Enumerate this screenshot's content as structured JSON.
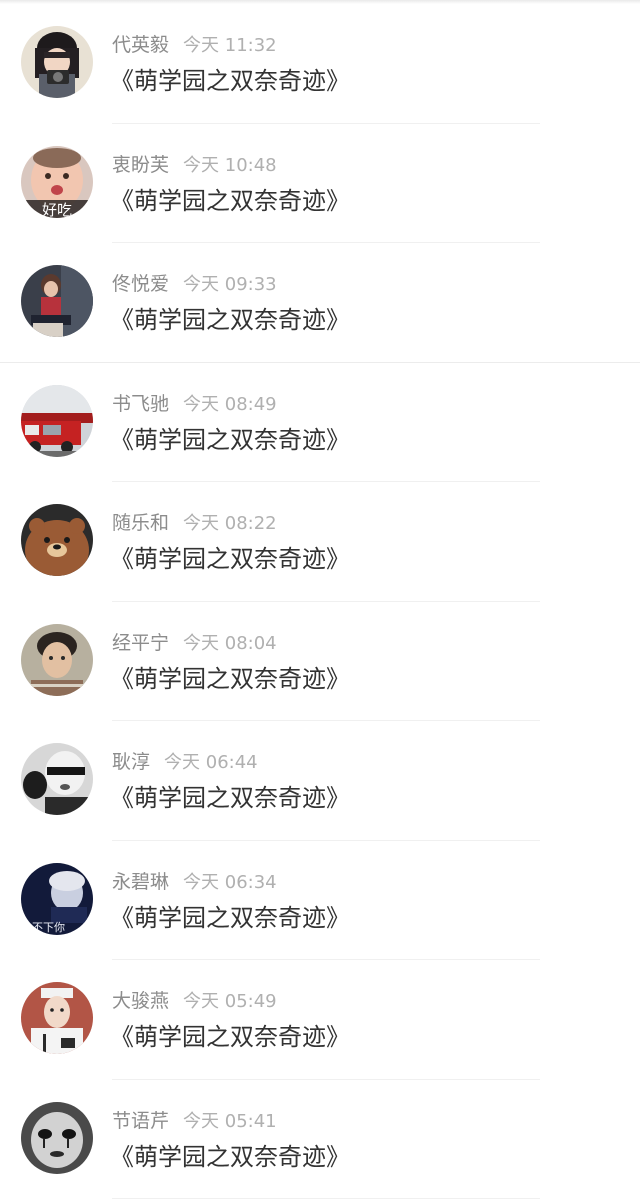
{
  "comments": [
    {
      "name": "代英毅",
      "time": "今天 11:32",
      "text": "《萌学园之双奈奇迹》",
      "avatar": "girl-with-camera-avatar"
    },
    {
      "name": "衷盼芙",
      "time": "今天 10:48",
      "text": "《萌学园之双奈奇迹》",
      "avatar": "baby-avatar",
      "avatar_caption": "好吃"
    },
    {
      "name": "佟悦爱",
      "time": "今天 09:33",
      "text": "《萌学园之双奈奇迹》",
      "avatar": "girl-sitting-avatar"
    },
    {
      "name": "书飞驰",
      "time": "今天 08:49",
      "text": "《萌学园之双奈奇迹》",
      "avatar": "fire-truck-avatar"
    },
    {
      "name": "随乐和",
      "time": "今天 08:22",
      "text": "《萌学园之双奈奇迹》",
      "avatar": "cartoon-bear-avatar"
    },
    {
      "name": "经平宁",
      "time": "今天 08:04",
      "text": "《萌学园之双奈奇迹》",
      "avatar": "boy-portrait-avatar"
    },
    {
      "name": "耿淳",
      "time": "今天 06:44",
      "text": "《萌学园之双奈奇迹》",
      "avatar": "bw-sunglasses-avatar"
    },
    {
      "name": "永碧琳",
      "time": "今天 06:34",
      "text": "《萌学园之双奈奇迹》",
      "avatar": "dark-blue-avatar",
      "avatar_caption": "放不下你"
    },
    {
      "name": "大骏燕",
      "time": "今天 05:49",
      "text": "《萌学园之双奈奇迹》",
      "avatar": "jersey-boy-avatar"
    },
    {
      "name": "节语芹",
      "time": "今天 05:41",
      "text": "《萌学园之双奈奇迹》",
      "avatar": "bw-doll-avatar"
    }
  ]
}
